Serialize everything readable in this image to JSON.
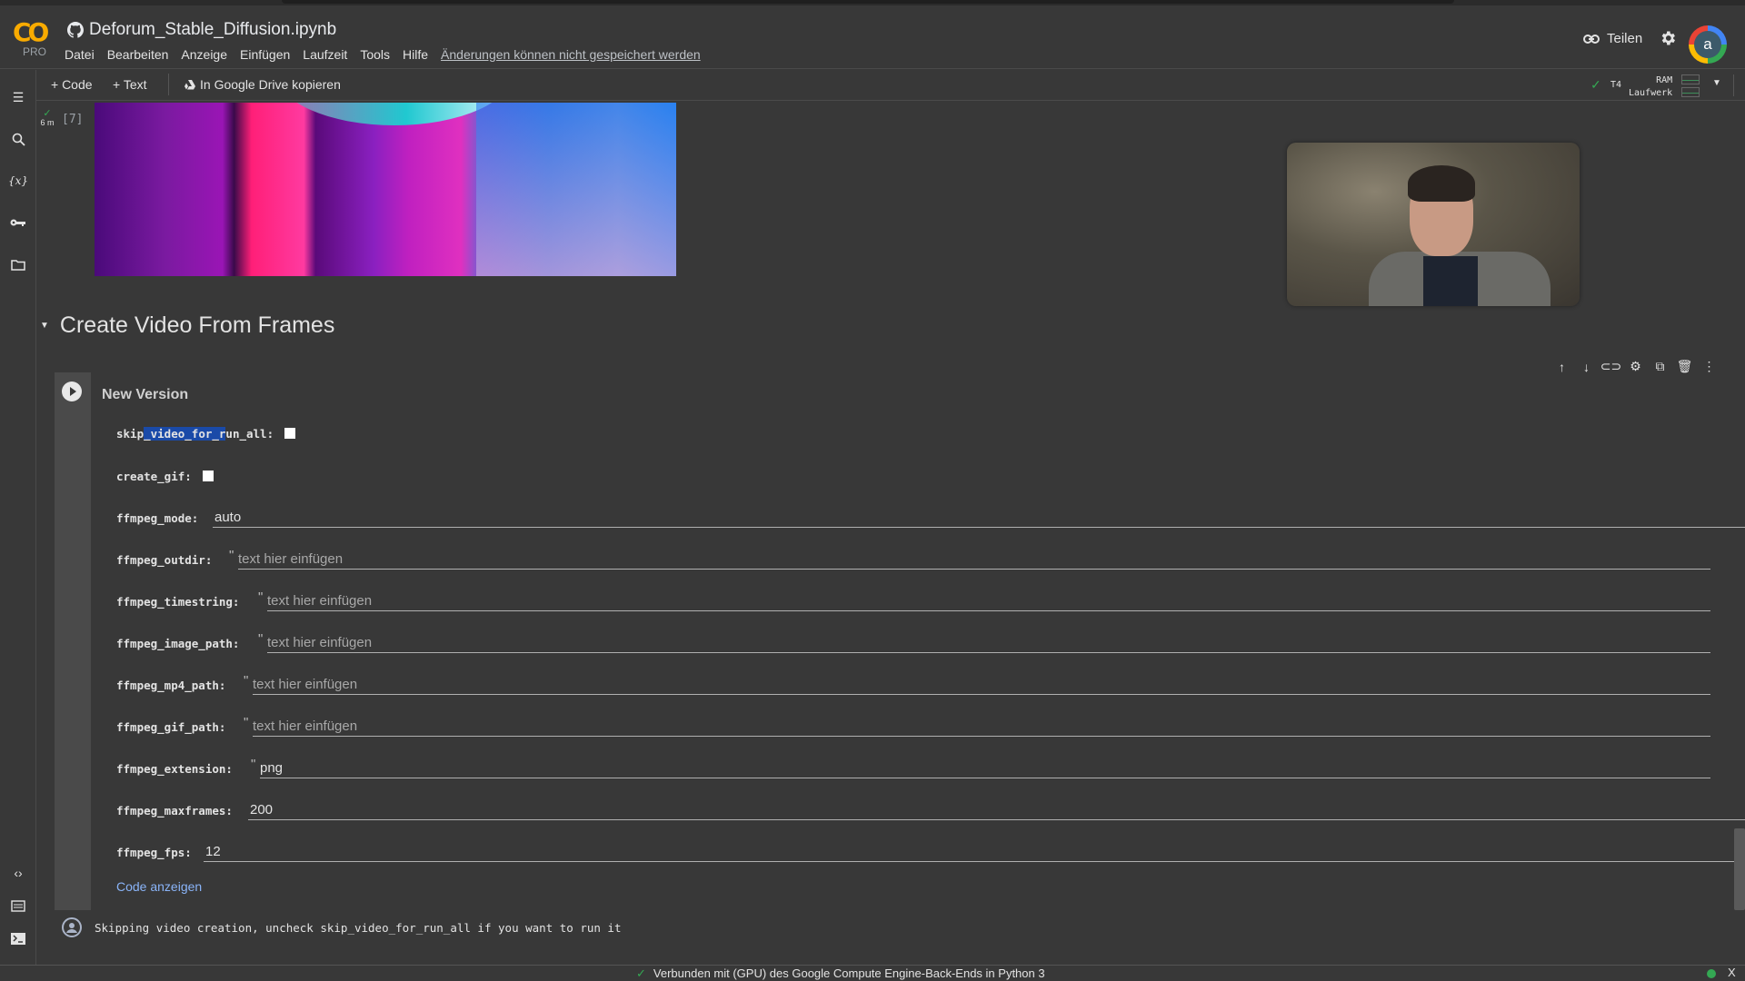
{
  "app": {
    "logo_text": "CO",
    "plan_badge": "PRO",
    "notebook_title": "Deforum_Stable_Diffusion.ipynb"
  },
  "menu": {
    "items": [
      "Datei",
      "Bearbeiten",
      "Anzeige",
      "Einfügen",
      "Laufzeit",
      "Tools",
      "Hilfe"
    ],
    "unsaved_notice": "Änderungen können nicht gespeichert werden"
  },
  "header_right": {
    "share_label": "Teilen",
    "avatar_letter": "a"
  },
  "toolbar": {
    "add_code": "+ Code",
    "add_text": "+ Text",
    "copy_drive": "In Google Drive kopieren"
  },
  "runtime": {
    "gpu": "T4",
    "ram_label": "RAM",
    "disk_label": "Laufwerk"
  },
  "prev_cell": {
    "exec_time": "6 m",
    "exec_count": "[7]"
  },
  "section": {
    "title": "Create Video From Frames"
  },
  "cell": {
    "form_title": "New Version",
    "fields": [
      {
        "label_pre": "skip",
        "label_sel": "_video_for_r",
        "label_post": "un_all:",
        "type": "checkbox",
        "checked": false
      },
      {
        "label": "create_gif:",
        "type": "checkbox",
        "checked": false
      },
      {
        "label": "ffmpeg_mode:",
        "type": "dropdown",
        "value": "auto"
      },
      {
        "label": "ffmpeg_outdir:",
        "type": "text",
        "placeholder": "text hier einfügen"
      },
      {
        "label": "ffmpeg_timestring:",
        "type": "text",
        "placeholder": "text hier einfügen"
      },
      {
        "label": "ffmpeg_image_path:",
        "type": "text",
        "placeholder": "text hier einfügen"
      },
      {
        "label": "ffmpeg_mp4_path:",
        "type": "text",
        "placeholder": "text hier einfügen"
      },
      {
        "label": "ffmpeg_gif_path:",
        "type": "text",
        "placeholder": "text hier einfügen"
      },
      {
        "label": "ffmpeg_extension:",
        "type": "text",
        "value": "png"
      },
      {
        "label": "ffmpeg_maxframes:",
        "type": "number",
        "value": "200"
      },
      {
        "label": "ffmpeg_fps:",
        "type": "number",
        "value": "12"
      }
    ],
    "show_code_link": "Code anzeigen",
    "output_text": "Skipping video creation, uncheck skip_video_for_run_all if you want to run it"
  },
  "statusbar": {
    "text": "Verbunden mit (GPU) des Google Compute Engine-Back-Ends in Python 3",
    "close": "X"
  },
  "colors": {
    "background": "#383838",
    "accent_link": "#8ab4f8",
    "ok_green": "#34a853",
    "logo_orange": "#f9ab00",
    "selection": "#1a4aa8"
  }
}
